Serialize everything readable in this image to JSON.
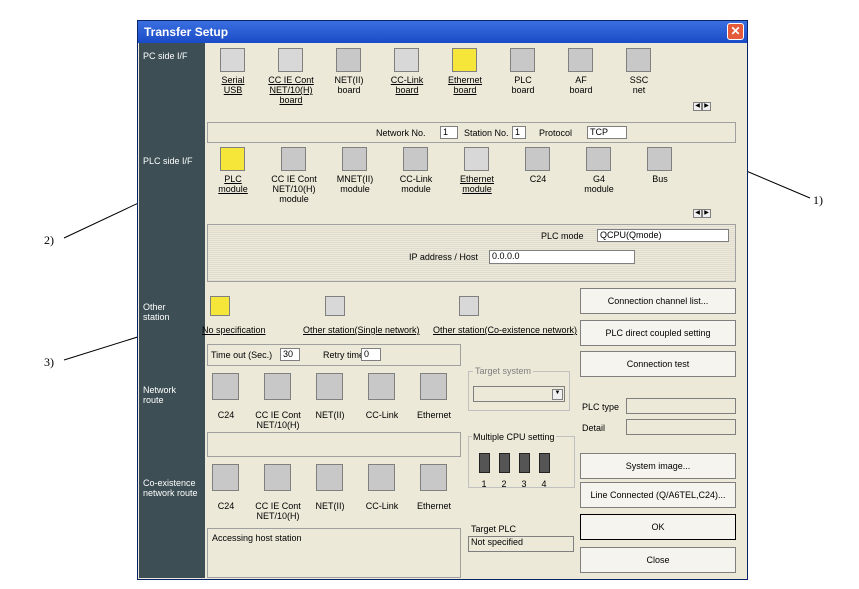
{
  "dialog": {
    "title": "Transfer Setup",
    "close_icon": "close-icon"
  },
  "pc_side": {
    "label": "PC side I/F",
    "items": [
      {
        "line1": "Serial",
        "line2": "USB",
        "line3": "",
        "icon": "serial-usb-icon"
      },
      {
        "line1": "CC IE Cont",
        "line2": "NET/10(H)",
        "line3": "board",
        "icon": "cc-ie-board-icon"
      },
      {
        "line1": "NET(II)",
        "line2": "board",
        "line3": "",
        "icon": "net-ii-board-icon"
      },
      {
        "line1": "CC-Link",
        "line2": "board",
        "line3": "",
        "icon": "cc-link-board-icon"
      },
      {
        "line1": "Ethernet",
        "line2": "board",
        "line3": "",
        "icon": "ethernet-board-icon"
      },
      {
        "line1": "PLC",
        "line2": "board",
        "line3": "",
        "icon": "plc-board-icon"
      },
      {
        "line1": "AF",
        "line2": "board",
        "line3": "",
        "icon": "af-board-icon"
      },
      {
        "line1": "SSC",
        "line2": "net",
        "line3": "",
        "icon": "ssc-net-icon"
      }
    ],
    "network_no_label": "Network No.",
    "network_no": "1",
    "station_no_label": "Station No.",
    "station_no": "1",
    "protocol_label": "Protocol",
    "protocol": "TCP"
  },
  "plc_side": {
    "label": "PLC side I/F",
    "items": [
      {
        "line1": "PLC",
        "line2": "module",
        "line3": "",
        "icon": "plc-module-icon"
      },
      {
        "line1": "CC IE Cont",
        "line2": "NET/10(H)",
        "line3": "module",
        "icon": "cc-ie-module-icon"
      },
      {
        "line1": "MNET(II)",
        "line2": "module",
        "line3": "",
        "icon": "mnet-module-icon"
      },
      {
        "line1": "CC-Link",
        "line2": "module",
        "line3": "",
        "icon": "cc-link-module-icon"
      },
      {
        "line1": "Ethernet",
        "line2": "module",
        "line3": "",
        "icon": "ethernet-module-icon"
      },
      {
        "line1": "C24",
        "line2": "",
        "line3": "",
        "icon": "c24-icon"
      },
      {
        "line1": "G4",
        "line2": "module",
        "line3": "",
        "icon": "g4-module-icon"
      },
      {
        "line1": "Bus",
        "line2": "",
        "line3": "",
        "icon": "bus-icon"
      }
    ],
    "plc_mode_label": "PLC mode",
    "plc_mode": "QCPU(Qmode)",
    "ip_label": "IP address / Host",
    "ip": "0.0.0.0"
  },
  "other_station": {
    "label_line1": "Other",
    "label_line2": "station",
    "items": [
      {
        "label": "No specification",
        "icon": "no-specification-icon"
      },
      {
        "label": "Other station(Single network)",
        "icon": "single-network-icon"
      },
      {
        "label": "Other station(Co-existence network)",
        "icon": "coexistence-network-icon"
      }
    ],
    "timeout_label": "Time out (Sec.)",
    "timeout": "30",
    "retry_label": "Retry times",
    "retry": "0"
  },
  "network_route": {
    "label_line1": "Network",
    "label_line2": "route",
    "items": [
      {
        "line1": "C24",
        "line2": ""
      },
      {
        "line1": "CC IE Cont",
        "line2": "NET/10(H)"
      },
      {
        "line1": "NET(II)",
        "line2": ""
      },
      {
        "line1": "CC-Link",
        "line2": ""
      },
      {
        "line1": "Ethernet",
        "line2": ""
      }
    ]
  },
  "target_system": {
    "label": "Target system",
    "value": ""
  },
  "multi_cpu": {
    "label": "Multiple CPU setting",
    "cpus": [
      "1",
      "2",
      "3",
      "4"
    ],
    "icon": "cpu-icon"
  },
  "coexist_route": {
    "label_line1": "Co-existence",
    "label_line2": "network route",
    "items": [
      {
        "line1": "C24",
        "line2": ""
      },
      {
        "line1": "CC IE Cont",
        "line2": "NET/10(H)"
      },
      {
        "line1": "NET(II)",
        "line2": ""
      },
      {
        "line1": "CC-Link",
        "line2": ""
      },
      {
        "line1": "Ethernet",
        "line2": ""
      }
    ],
    "status": "Accessing host station"
  },
  "target_plc": {
    "label": "Target PLC",
    "value": "Not specified"
  },
  "buttons": {
    "connection_channel_list": "Connection channel list...",
    "plc_direct": "PLC direct coupled setting",
    "connection_test": "Connection test",
    "system_image": "System image...",
    "line_connected": "Line Connected (Q/A6TEL,C24)...",
    "ok": "OK",
    "close": "Close"
  },
  "plc_type": {
    "label": "PLC type",
    "value": "",
    "detail_label": "Detail",
    "detail_value": ""
  },
  "callouts": {
    "c1": "1)",
    "c2": "2)",
    "c3": "3)"
  }
}
